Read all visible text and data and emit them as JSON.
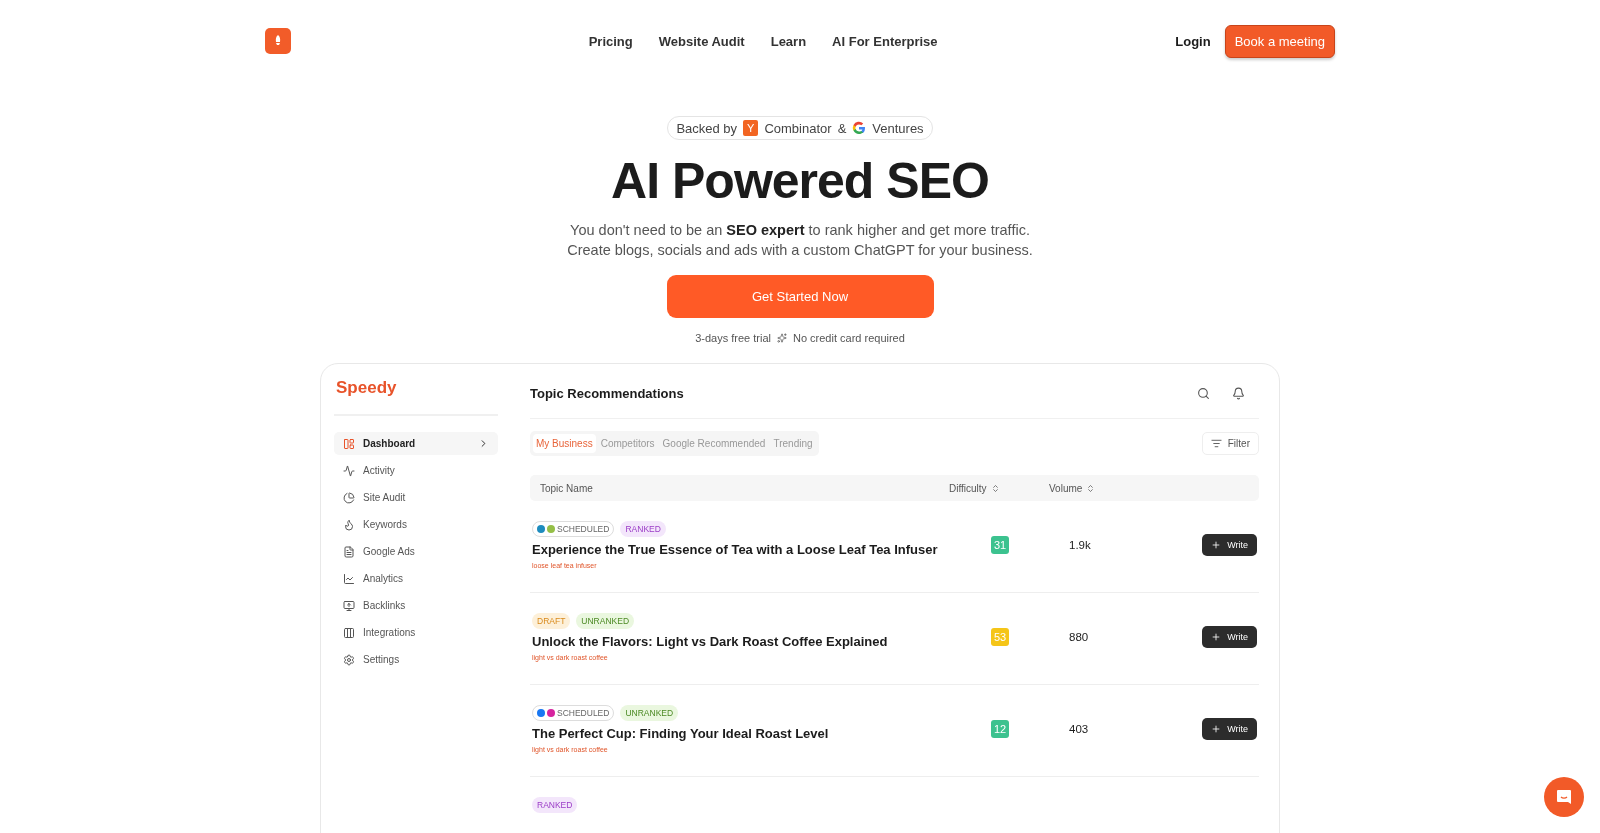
{
  "nav": {
    "links": [
      {
        "label": "Pricing"
      },
      {
        "label": "Website Audit"
      },
      {
        "label": "Learn"
      },
      {
        "label": "AI For Enterprise"
      }
    ],
    "login": "Login",
    "cta": "Book a meeting"
  },
  "hero": {
    "backed_by": "Backed by",
    "badge_letter": "Y",
    "combinator": "Combinator",
    "amp": "&",
    "ventures": "Ventures",
    "title": "AI Powered SEO",
    "subtitle": [
      "You don't need to be an **SEO expert** to rank higher and get more traffic.",
      "Create blogs, socials and ads with a custom ChatGPT for your business."
    ],
    "button": "Get Started Now",
    "trial": "3-days free trial",
    "no_card": "No credit card required"
  },
  "app": {
    "logo": "Speedy",
    "sidebar": [
      {
        "label": "Dashboard",
        "selected": true
      },
      {
        "label": "Activity",
        "selected": false
      },
      {
        "label": "Site Audit",
        "selected": false
      },
      {
        "label": "Keywords",
        "selected": false
      },
      {
        "label": "Google Ads",
        "selected": false
      },
      {
        "label": "Analytics",
        "selected": false
      },
      {
        "label": "Backlinks",
        "selected": false
      },
      {
        "label": "Integrations",
        "selected": false
      },
      {
        "label": "Settings",
        "selected": false
      }
    ],
    "title": "Topic Recommendations",
    "tabs": [
      {
        "label": "My Business",
        "selected": true
      },
      {
        "label": "Competitors",
        "selected": false
      },
      {
        "label": "Google Recommended",
        "selected": false
      },
      {
        "label": "Trending",
        "selected": false
      }
    ],
    "filter": "Filter",
    "columns": [
      "Topic Name",
      "Difficulty",
      "Volume"
    ],
    "rows": [
      {
        "tags": [
          {
            "kind": "scheduled",
            "label": "SCHEDULED"
          },
          {
            "kind": "ranked",
            "label": "RANKED"
          }
        ],
        "title": "Experience the True Essence of Tea with a Loose Leaf Tea Infuser",
        "keyword": "loose leaf tea infuser",
        "difficulty": "31",
        "color": "#3cc28f",
        "volume": "1.9k",
        "button": "Write"
      },
      {
        "tags": [
          {
            "kind": "draft",
            "label": "DRAFT"
          },
          {
            "kind": "unranked",
            "label": "UNRANKED"
          }
        ],
        "title": "Unlock the Flavors: Light vs Dark Roast Coffee Explained",
        "keyword": "light vs dark roast coffee",
        "difficulty": "53",
        "color": "#f5c518",
        "volume": "880",
        "button": "Write"
      },
      {
        "tags": [
          {
            "kind": "scheduled",
            "label": "SCHEDULED"
          },
          {
            "kind": "unranked",
            "label": "UNRANKED"
          }
        ],
        "title": "The Perfect Cup: Finding Your Ideal Roast Level",
        "keyword": "light vs dark roast coffee",
        "difficulty": "12",
        "color": "#3cc28f",
        "volume": "403",
        "button": "Write"
      },
      {
        "tags": [
          {
            "kind": "ranked",
            "label": "RANKED"
          }
        ]
      }
    ]
  }
}
